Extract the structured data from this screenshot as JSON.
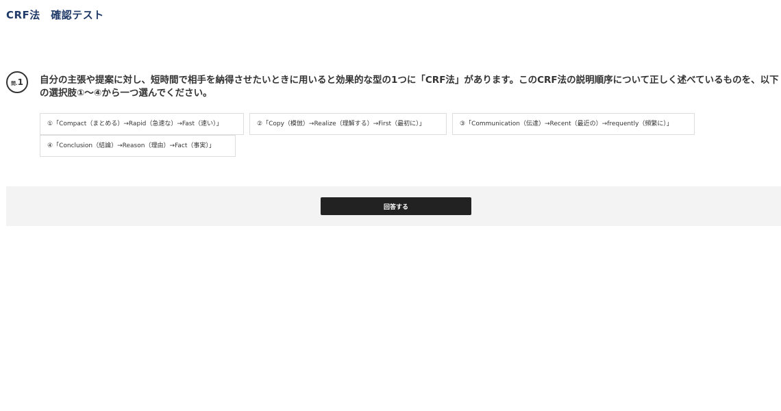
{
  "page": {
    "title": "CRF法　確認テスト"
  },
  "question": {
    "badge_prefix": "問.",
    "badge_number": "1",
    "text": "自分の主張や提案に対し、短時間で相手を納得させたいときに用いると効果的な型の1つに「CRF法」があります。このCRF法の説明順序について正しく述べているものを、以下の選択肢①～④から一つ選んでください。"
  },
  "choices": [
    {
      "label": "①「Compact（まとめる）→Rapid（急速な）→Fast（速い）」"
    },
    {
      "label": "②「Copy（模倣）→Realize（理解する）→First（最初に）」"
    },
    {
      "label": "③「Communication（伝達）→Recent（最近の）→frequently（頻繁に）」"
    },
    {
      "label": "④「Conclusion（結論）→Reason（理由）→Fact（事実）」"
    }
  ],
  "answer": {
    "button_label": "回答する"
  },
  "colors": {
    "title": "#1f3a68",
    "text": "#333333",
    "choice_border": "#dddddd",
    "answer_bar_bg": "#f3f3f3",
    "button_bg": "#222222",
    "button_text": "#ffffff"
  }
}
